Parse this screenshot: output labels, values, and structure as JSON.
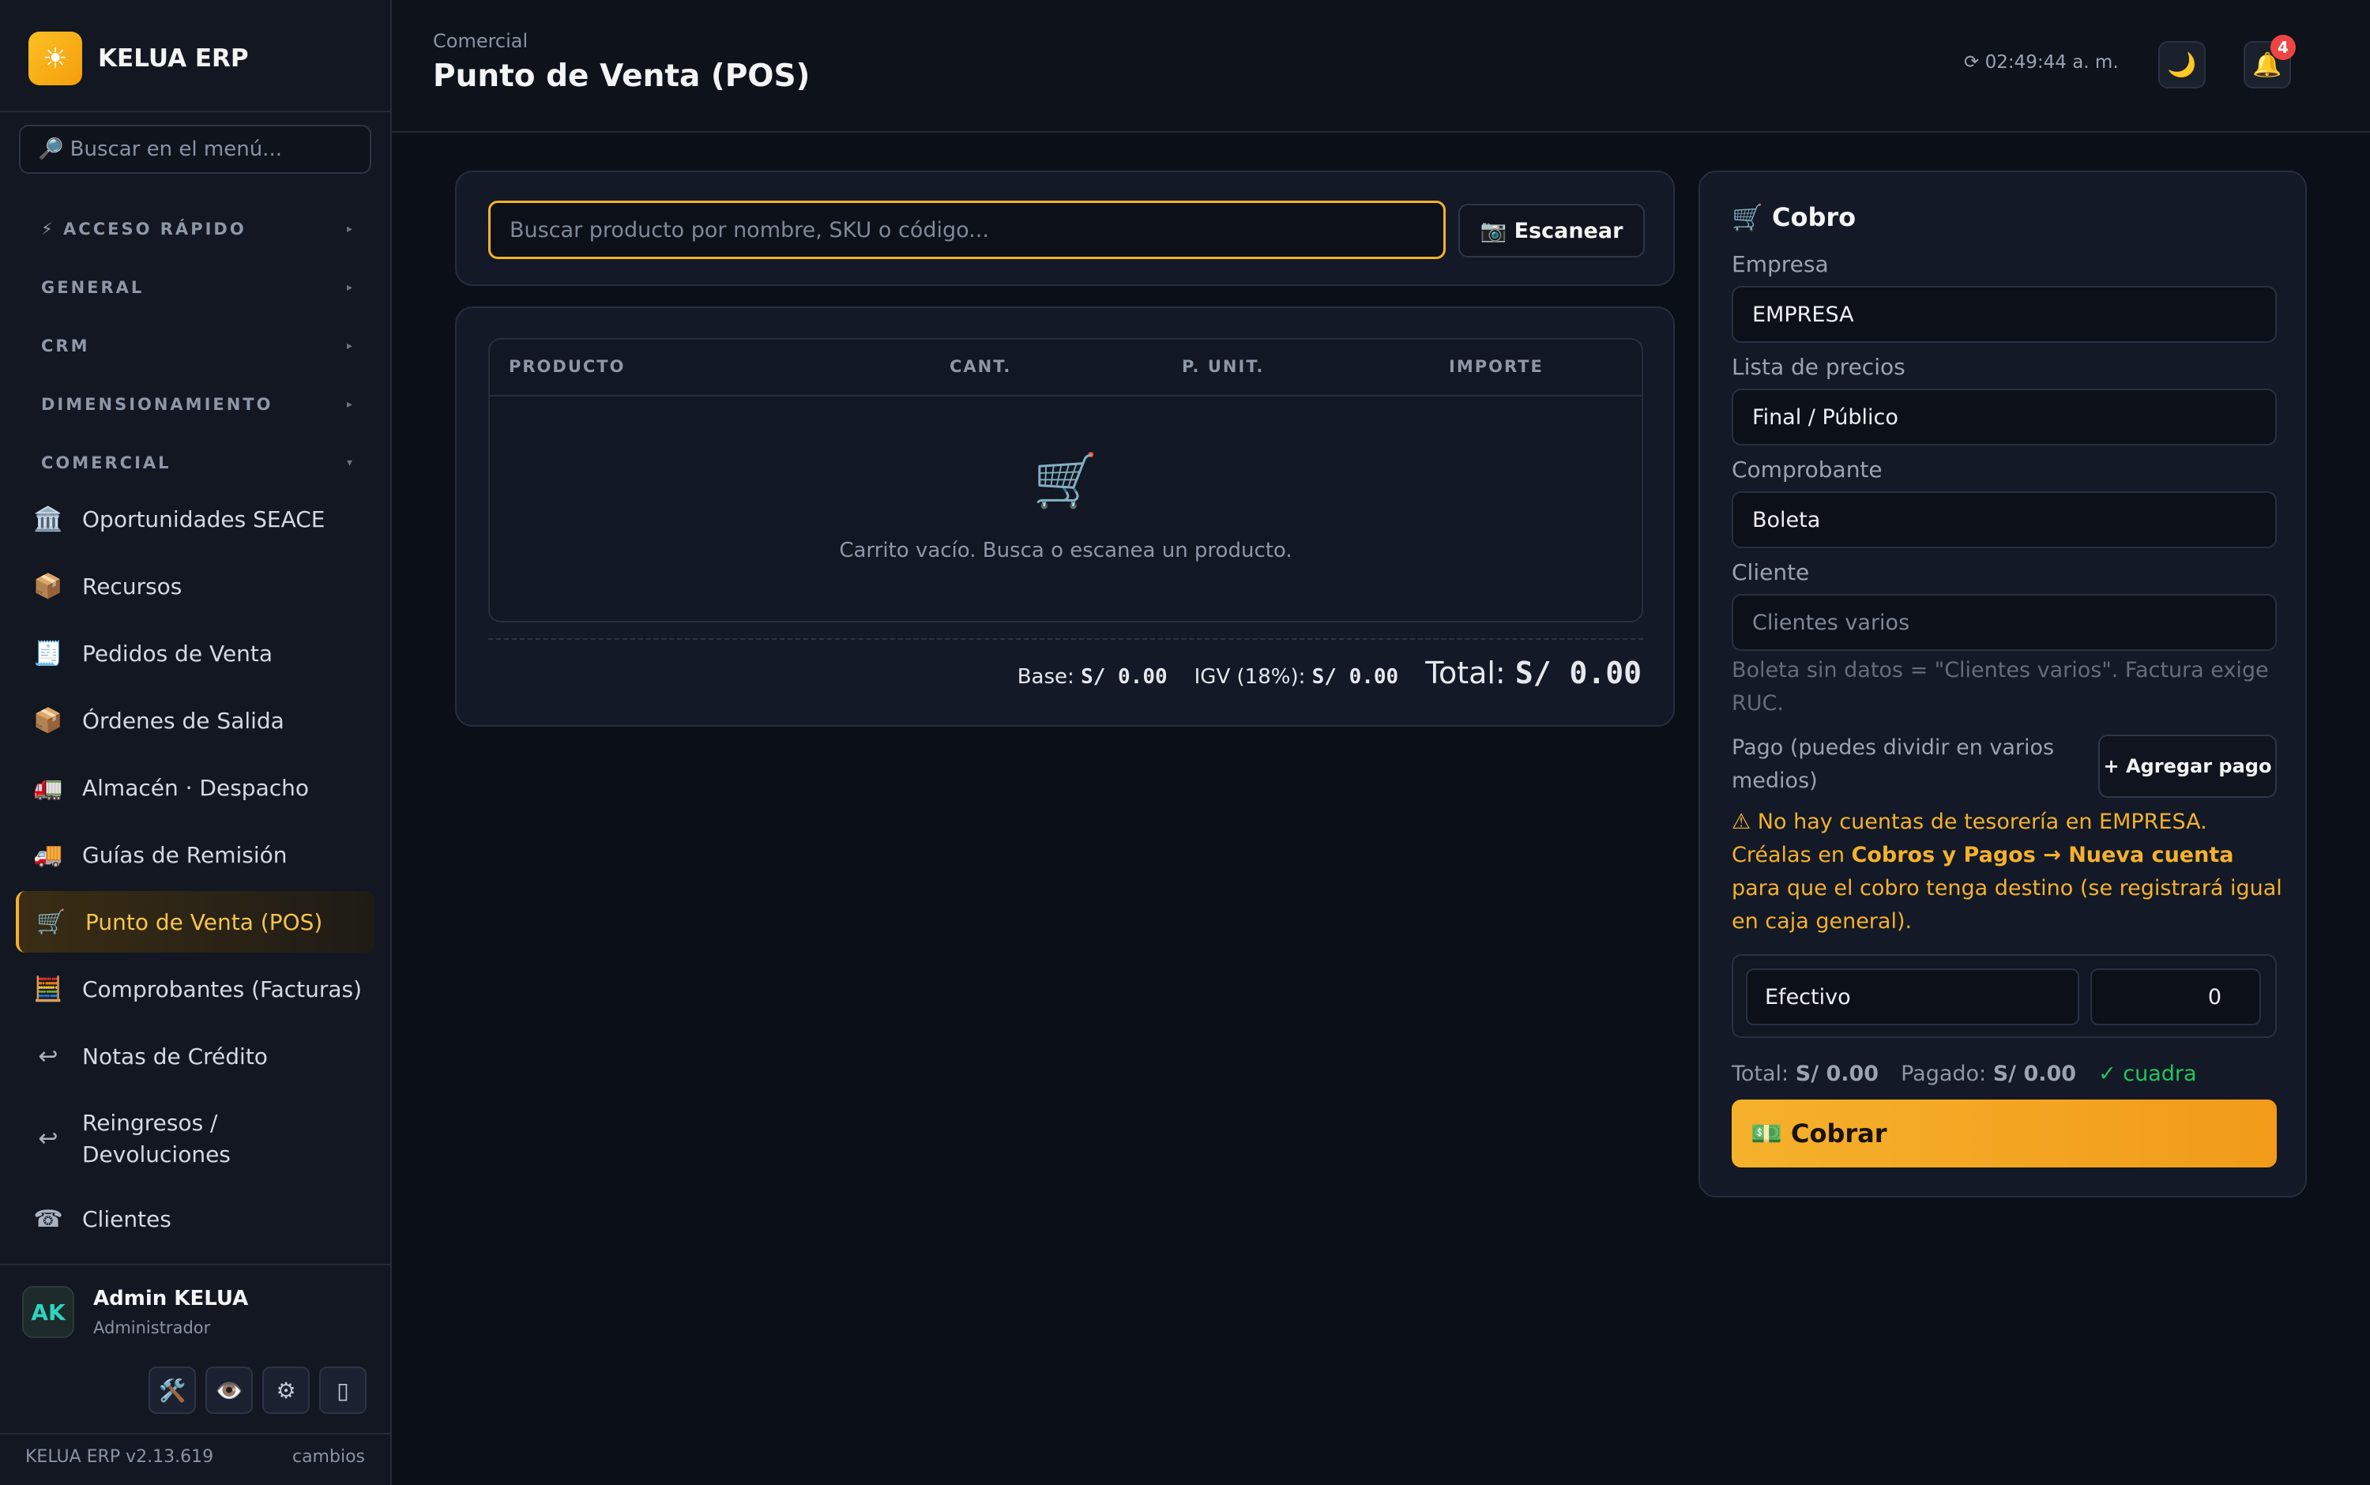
{
  "brand": {
    "name": "KELUA ERP",
    "logo_icon": "☀"
  },
  "sidebar": {
    "search_placeholder": "🔎 Buscar en el menú...",
    "sections": [
      {
        "label": "⚡ ACCESO RÁPIDO",
        "chevron": "▸"
      },
      {
        "label": "GENERAL",
        "chevron": "▸"
      },
      {
        "label": "CRM",
        "chevron": "▸"
      },
      {
        "label": "DIMENSIONAMIENTO",
        "chevron": "▸"
      },
      {
        "label": "COMERCIAL",
        "chevron": "▾"
      }
    ],
    "items": [
      {
        "icon": "🏛️",
        "label": "Oportunidades SEACE"
      },
      {
        "icon": "📦",
        "label": "Recursos"
      },
      {
        "icon": "🧾",
        "label": "Pedidos de Venta"
      },
      {
        "icon": "📦",
        "label": "Órdenes de Salida"
      },
      {
        "icon": "🚛",
        "label": "Almacén · Despacho"
      },
      {
        "icon": "🚚",
        "label": "Guías de Remisión"
      },
      {
        "icon": "🛒",
        "label": "Punto de Venta (POS)"
      },
      {
        "icon": "🧮",
        "label": "Comprobantes (Facturas)"
      },
      {
        "icon": "↩",
        "label": "Notas de Crédito"
      },
      {
        "icon": "↩",
        "label": "Reingresos / Devoluciones"
      },
      {
        "icon": "☎",
        "label": "Clientes"
      }
    ],
    "active_item": "Punto de Venta (POS)",
    "user": {
      "initials": "AK",
      "name": "Admin KELUA",
      "role": "Administrador"
    },
    "tools": [
      "🛠️",
      "👁️",
      "⚙",
      "▯"
    ],
    "footer": {
      "version": "KELUA ERP v2.13.619",
      "changes_link": "cambios"
    }
  },
  "header": {
    "breadcrumb": "Comercial",
    "title": "Punto de Venta (POS)",
    "clock": "⟳ 02:49:44 a. m.",
    "theme_icon": "🌙",
    "bell_icon": "🔔",
    "notification_count": "4"
  },
  "pos": {
    "search_placeholder": "Buscar producto por nombre, SKU o código...",
    "scan_label": "📷 Escanear",
    "columns": [
      "PRODUCTO",
      "CANT.",
      "P. UNIT.",
      "IMPORTE"
    ],
    "empty_icon": "🛒",
    "empty_message": "Carrito vacío. Busca o escanea un producto.",
    "base_label": "Base:",
    "base_value": "S/ 0.00",
    "igv_label": "IGV (18%):",
    "igv_value": "S/ 0.00",
    "total_label": "Total:",
    "total_value": "S/ 0.00"
  },
  "cobro": {
    "title": "🛒 Cobro",
    "empresa_label": "Empresa",
    "empresa_value": "EMPRESA",
    "lista_label": "Lista de precios",
    "lista_value": "Final / Público",
    "comprobante_label": "Comprobante",
    "comprobante_value": "Boleta",
    "cliente_label": "Cliente",
    "cliente_placeholder": "Clientes varios",
    "hint": "Boleta sin datos = \"Clientes varios\". Factura exige RUC.",
    "pago_label": "Pago (puedes dividir en varios medios)",
    "add_pago_label": "+ Agregar pago",
    "warning": {
      "prefix": "⚠ No hay cuentas de tesorería en EMPRESA. Créalas en ",
      "link": "Cobros y Pagos → Nueva cuenta",
      "suffix": " para que el cobro tenga destino (se registrará igual en caja general)."
    },
    "payment_method": "Efectivo",
    "payment_amount": "0",
    "summary": {
      "total_label": "Total:",
      "total_value": "S/ 0.00",
      "paid_label": "Pagado:",
      "paid_value": "S/ 0.00",
      "status": "✓ cuadra"
    },
    "charge_label": "💵 Cobrar"
  },
  "colors": {
    "accent": "#f5b12c",
    "background": "#0b0f17",
    "success": "#22c55e",
    "danger": "#ef4444"
  }
}
